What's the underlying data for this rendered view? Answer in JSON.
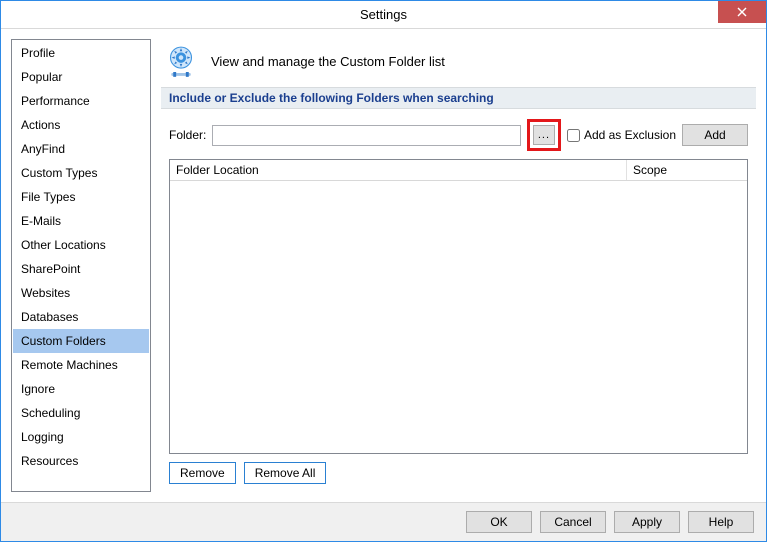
{
  "window": {
    "title": "Settings"
  },
  "sidebar": {
    "items": [
      {
        "label": "Profile"
      },
      {
        "label": "Popular"
      },
      {
        "label": "Performance"
      },
      {
        "label": "Actions"
      },
      {
        "label": "AnyFind"
      },
      {
        "label": "Custom Types"
      },
      {
        "label": "File Types"
      },
      {
        "label": "E-Mails"
      },
      {
        "label": "Other Locations"
      },
      {
        "label": "SharePoint"
      },
      {
        "label": "Websites"
      },
      {
        "label": "Databases"
      },
      {
        "label": "Custom Folders",
        "selected": true
      },
      {
        "label": "Remote Machines"
      },
      {
        "label": "Ignore"
      },
      {
        "label": "Scheduling"
      },
      {
        "label": "Logging"
      },
      {
        "label": "Resources"
      }
    ]
  },
  "main": {
    "header": "View and manage the Custom Folder list",
    "section_title": "Include or Exclude the following Folders when searching",
    "folder_label": "Folder:",
    "folder_value": "",
    "browse_label": "...",
    "exclusion_label": "Add as Exclusion",
    "add_label": "Add",
    "table": {
      "col_location": "Folder Location",
      "col_scope": "Scope"
    },
    "remove_label": "Remove",
    "remove_all_label": "Remove All"
  },
  "footer": {
    "ok": "OK",
    "cancel": "Cancel",
    "apply": "Apply",
    "help": "Help"
  }
}
